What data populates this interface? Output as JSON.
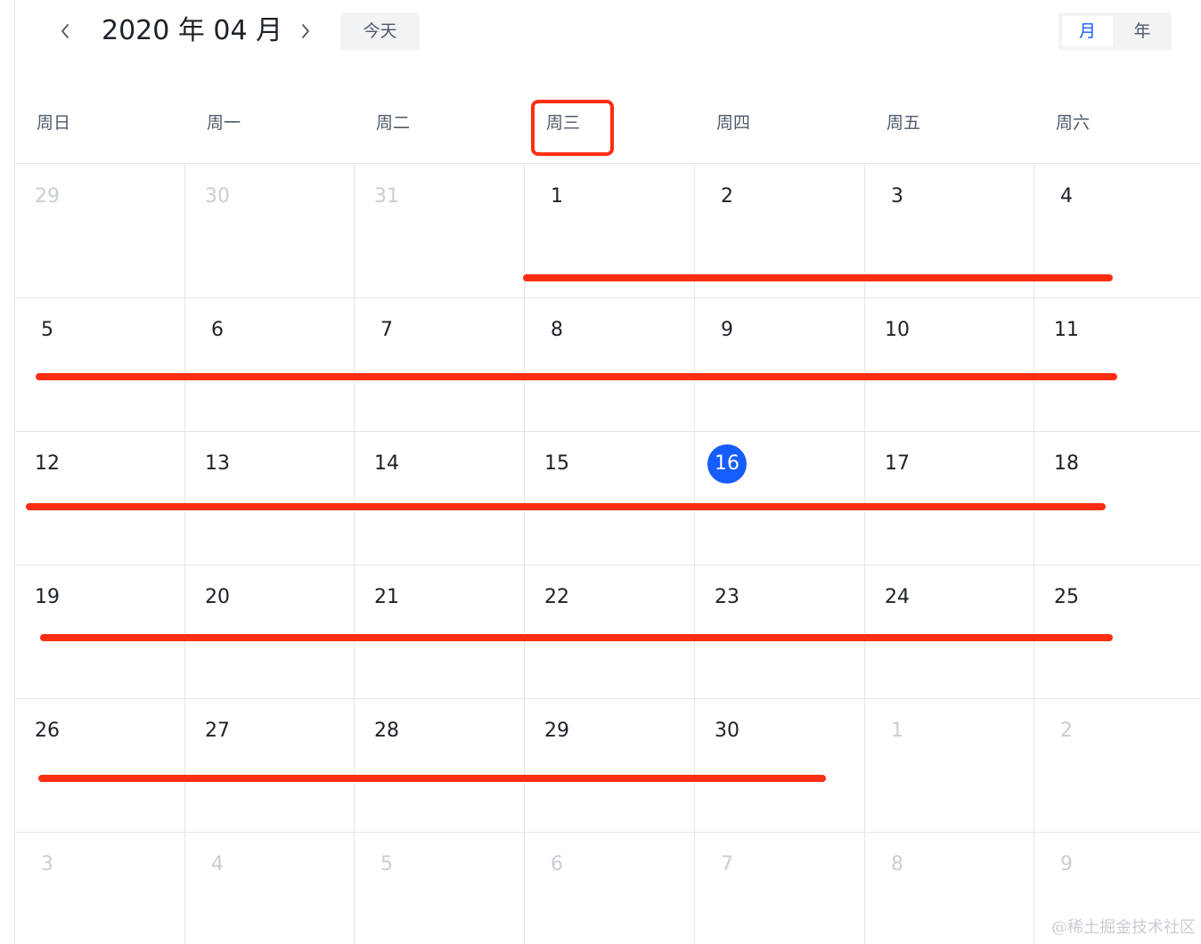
{
  "header": {
    "title": "2020 年 04 月",
    "prev_icon": "chevron-left-icon",
    "next_icon": "chevron-right-icon",
    "today_label": "今天",
    "modes": [
      {
        "label": "月",
        "active": true
      },
      {
        "label": "年",
        "active": false
      }
    ]
  },
  "weekdays": [
    "周日",
    "周一",
    "周二",
    "周三",
    "周四",
    "周五",
    "周六"
  ],
  "weeks": [
    [
      {
        "d": "29",
        "muted": true
      },
      {
        "d": "30",
        "muted": true
      },
      {
        "d": "31",
        "muted": true
      },
      {
        "d": "1"
      },
      {
        "d": "2"
      },
      {
        "d": "3"
      },
      {
        "d": "4"
      }
    ],
    [
      {
        "d": "5"
      },
      {
        "d": "6"
      },
      {
        "d": "7"
      },
      {
        "d": "8"
      },
      {
        "d": "9"
      },
      {
        "d": "10"
      },
      {
        "d": "11"
      }
    ],
    [
      {
        "d": "12"
      },
      {
        "d": "13"
      },
      {
        "d": "14"
      },
      {
        "d": "15"
      },
      {
        "d": "16",
        "today": true
      },
      {
        "d": "17"
      },
      {
        "d": "18"
      }
    ],
    [
      {
        "d": "19"
      },
      {
        "d": "20"
      },
      {
        "d": "21"
      },
      {
        "d": "22"
      },
      {
        "d": "23"
      },
      {
        "d": "24"
      },
      {
        "d": "25"
      }
    ],
    [
      {
        "d": "26"
      },
      {
        "d": "27"
      },
      {
        "d": "28"
      },
      {
        "d": "29"
      },
      {
        "d": "30"
      },
      {
        "d": "1",
        "muted": true
      },
      {
        "d": "2",
        "muted": true
      }
    ],
    [
      {
        "d": "3",
        "muted": true
      },
      {
        "d": "4",
        "muted": true
      },
      {
        "d": "5",
        "muted": true
      },
      {
        "d": "6",
        "muted": true
      },
      {
        "d": "7",
        "muted": true
      },
      {
        "d": "8",
        "muted": true
      },
      {
        "d": "9",
        "muted": true
      }
    ]
  ],
  "colors": {
    "accent": "#165dff",
    "annotation": "#ff2d12",
    "muted_text": "#c9cdd4"
  },
  "watermark": "@稀土掘金技术社区"
}
